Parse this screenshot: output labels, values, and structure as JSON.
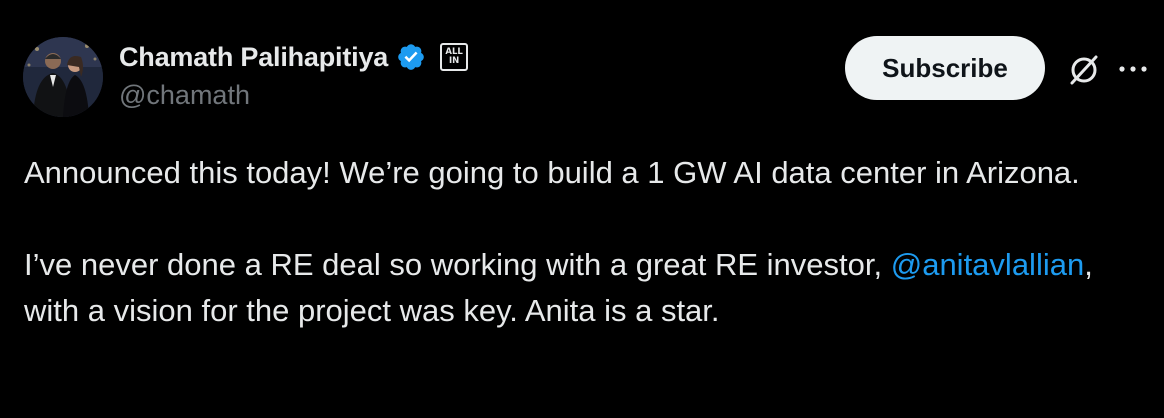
{
  "author": {
    "display_name": "Chamath Palihapitiya",
    "handle": "@chamath",
    "verified": true,
    "affiliate_badge": {
      "line1": "ALL",
      "line2": "IN"
    }
  },
  "actions": {
    "subscribe_label": "Subscribe"
  },
  "tweet": {
    "paragraph1": "Announced this today! We’re going to build a 1 GW AI data center in Arizona.",
    "paragraph2_before": "I’ve never done a RE deal so working with a great RE investor, ",
    "mention": "@anitavlallian",
    "paragraph2_after": ", with a vision for the project was key. Anita is a star."
  },
  "colors": {
    "background": "#000000",
    "text": "#e7e9ea",
    "secondary_text": "#71767b",
    "link": "#1d9bf0",
    "verified": "#1d9bf0",
    "button_bg": "#eff3f4"
  },
  "icons": {
    "verified": "verified-badge-icon",
    "grok": "grok-icon",
    "more": "more-options-icon"
  }
}
